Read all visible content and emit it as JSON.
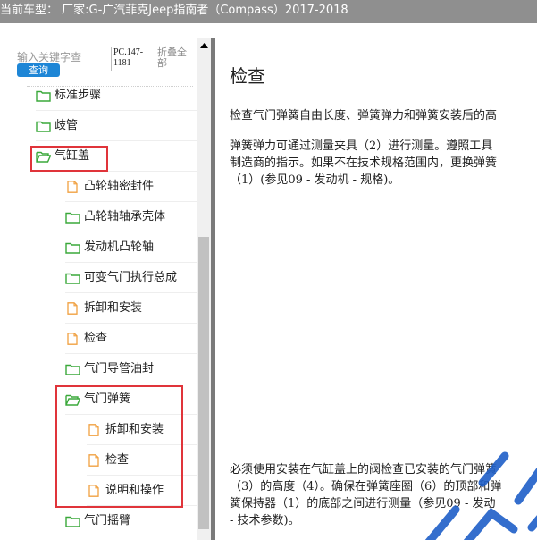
{
  "title_bar": {
    "text": "当前车型： 厂家:G-广汽菲克Jeep指南者（Compass）2017-2018"
  },
  "search": {
    "placeholder": "输入关键字查",
    "query_label": "查询",
    "pc_code": "PC.147-1181",
    "collapse_all": "折叠全部"
  },
  "tree": {
    "items": [
      {
        "label": "标准步骤",
        "icon": "folder-closed-icon",
        "level": 1
      },
      {
        "label": "歧管",
        "icon": "folder-closed-icon",
        "level": 1
      },
      {
        "label": "气缸盖",
        "icon": "folder-open-icon",
        "level": 1
      },
      {
        "label": "凸轮轴密封件",
        "icon": "document-icon",
        "level": 2
      },
      {
        "label": "凸轮轴轴承壳体",
        "icon": "folder-closed-icon",
        "level": 2
      },
      {
        "label": "发动机凸轮轴",
        "icon": "folder-closed-icon",
        "level": 2
      },
      {
        "label": "可变气门执行总成",
        "icon": "folder-closed-icon",
        "level": 2
      },
      {
        "label": "拆卸和安装",
        "icon": "document-icon",
        "level": 2
      },
      {
        "label": "检查",
        "icon": "document-icon",
        "level": 2
      },
      {
        "label": "气门导管油封",
        "icon": "folder-closed-icon",
        "level": 2
      },
      {
        "label": "气门弹簧",
        "icon": "folder-open-icon",
        "level": 2
      },
      {
        "label": "拆卸和安装",
        "icon": "document-icon",
        "level": 3
      },
      {
        "label": "检查",
        "icon": "document-icon",
        "level": 3
      },
      {
        "label": "说明和操作",
        "icon": "document-icon",
        "level": 3
      },
      {
        "label": "气门摇臂",
        "icon": "folder-closed-icon",
        "level": 2
      }
    ]
  },
  "document": {
    "heading": "检查",
    "para1": "检查气门弹簧自由长度、弹簧弹力和弹簧安装后的高",
    "para2_line1": "弹簧弹力可通过测量夹具（2）进行测量。遵照工具",
    "para2_line2": "制造商的指示。如果不在技术规格范围内，更换弹簧",
    "para2_line3": "（1）(参见09 - 发动机 - 规格)。",
    "para3_line1": "必须使用安装在气缸盖上的阀检查已安装的气门弹簧",
    "para3_line2": "（3）的高度（4）。确保在弹簧座圈（6）的顶部和弹",
    "para3_line3": "簧保持器（1）的底部之间进行测量（参见09 - 发动",
    "para3_line4": "- 技术参数)。"
  },
  "colors": {
    "highlight": "#e0343a",
    "folder_green": "#3aa83a",
    "document_orange": "#f0a040",
    "query_button": "#1e86d6"
  }
}
